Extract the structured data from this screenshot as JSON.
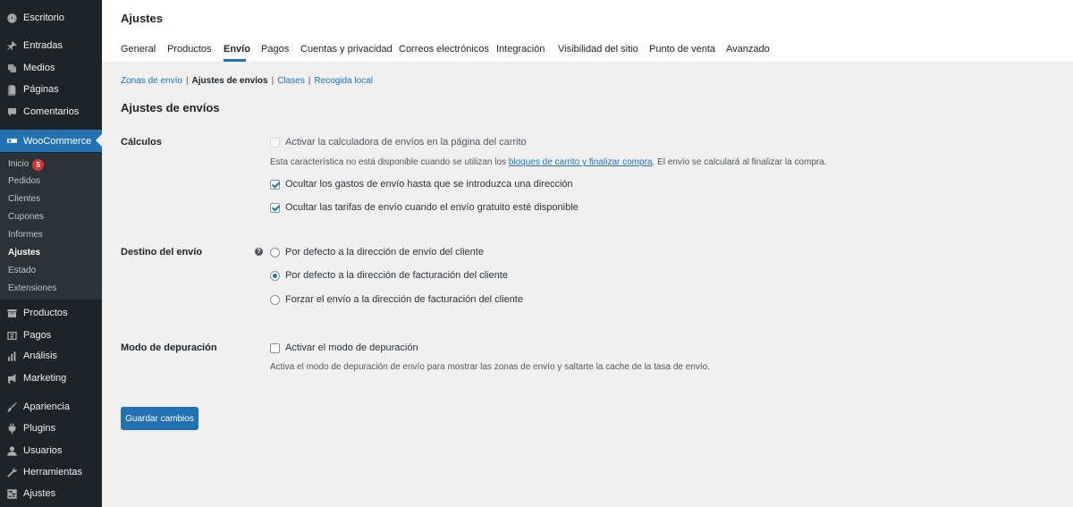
{
  "sidebar": {
    "top_items": [
      {
        "label": "Escritorio",
        "icon": "dashboard-icon"
      },
      {
        "label": "Entradas",
        "icon": "pin-icon"
      },
      {
        "label": "Medios",
        "icon": "media-icon"
      },
      {
        "label": "Páginas",
        "icon": "pages-icon"
      },
      {
        "label": "Comentarios",
        "icon": "comment-icon"
      },
      {
        "label": "WooCommerce",
        "icon": "woocommerce-icon"
      }
    ],
    "submenu": [
      {
        "label": "Inicio",
        "badge": "5"
      },
      {
        "label": "Pedidos"
      },
      {
        "label": "Clientes"
      },
      {
        "label": "Cupones"
      },
      {
        "label": "Informes"
      },
      {
        "label": "Ajustes"
      },
      {
        "label": "Estado"
      },
      {
        "label": "Extensiones"
      }
    ],
    "bottom_items": [
      {
        "label": "Productos",
        "icon": "archive-icon"
      },
      {
        "label": "Pagos",
        "icon": "dollar-icon"
      },
      {
        "label": "Análisis",
        "icon": "bar-chart-icon"
      },
      {
        "label": "Marketing",
        "icon": "megaphone-icon"
      },
      {
        "label": "Apariencia",
        "icon": "brush-icon"
      },
      {
        "label": "Plugins",
        "icon": "plugin-icon"
      },
      {
        "label": "Usuarios",
        "icon": "user-icon"
      },
      {
        "label": "Herramientas",
        "icon": "wrench-icon"
      },
      {
        "label": "Ajustes",
        "icon": "settings-icon"
      }
    ]
  },
  "header": {
    "title": "Ajustes",
    "tabs": [
      "General",
      "Productos",
      "Envío",
      "Pagos",
      "Cuentas y privacidad",
      "Correos electrónicos",
      "Integración",
      "Visibilidad del sitio",
      "Punto de venta",
      "Avanzado"
    ],
    "active_tab": "Envío"
  },
  "subnav": {
    "items": [
      "Zonas de envío",
      "Ajustes de envíos",
      "Clases",
      "Recogida local"
    ],
    "current": "Ajustes de envíos",
    "separator": "|"
  },
  "section_title": "Ajustes de envíos",
  "calculos": {
    "label": "Cálculos",
    "opt_calculator": "Activar la calculadora de envíos en la página del carrito",
    "desc_before": "Esta característica no está disponible cuando se utilizan los ",
    "desc_link": "bloques de carrito y finalizar compra",
    "desc_after": ". El envío se calculará al finalizar la compra.",
    "opt_hide_costs": "Ocultar los gastos de envío hasta que se introduzca una dirección",
    "opt_hide_rates": "Ocultar las tarifas de envío cuando el envío gratuito esté disponible"
  },
  "destino": {
    "label": "Destino del envío",
    "help": "?",
    "options": [
      "Por defecto a la dirección de envío del cliente",
      "Por defecto a la dirección de facturación del cliente",
      "Forzar el envío a la dirección de facturación del cliente"
    ],
    "selected": 1
  },
  "debug": {
    "label": "Modo de depuración",
    "option": "Activar el modo de depuración",
    "desc": "Activa el modo de depuración de envío para mostrar las zonas de envío y saltarte la cache de la tasa de envío."
  },
  "save_label": "Guardar cambios",
  "colors": {
    "accent": "#2271b1",
    "sidebar_bg": "#1d2327",
    "badge": "#d63638"
  }
}
